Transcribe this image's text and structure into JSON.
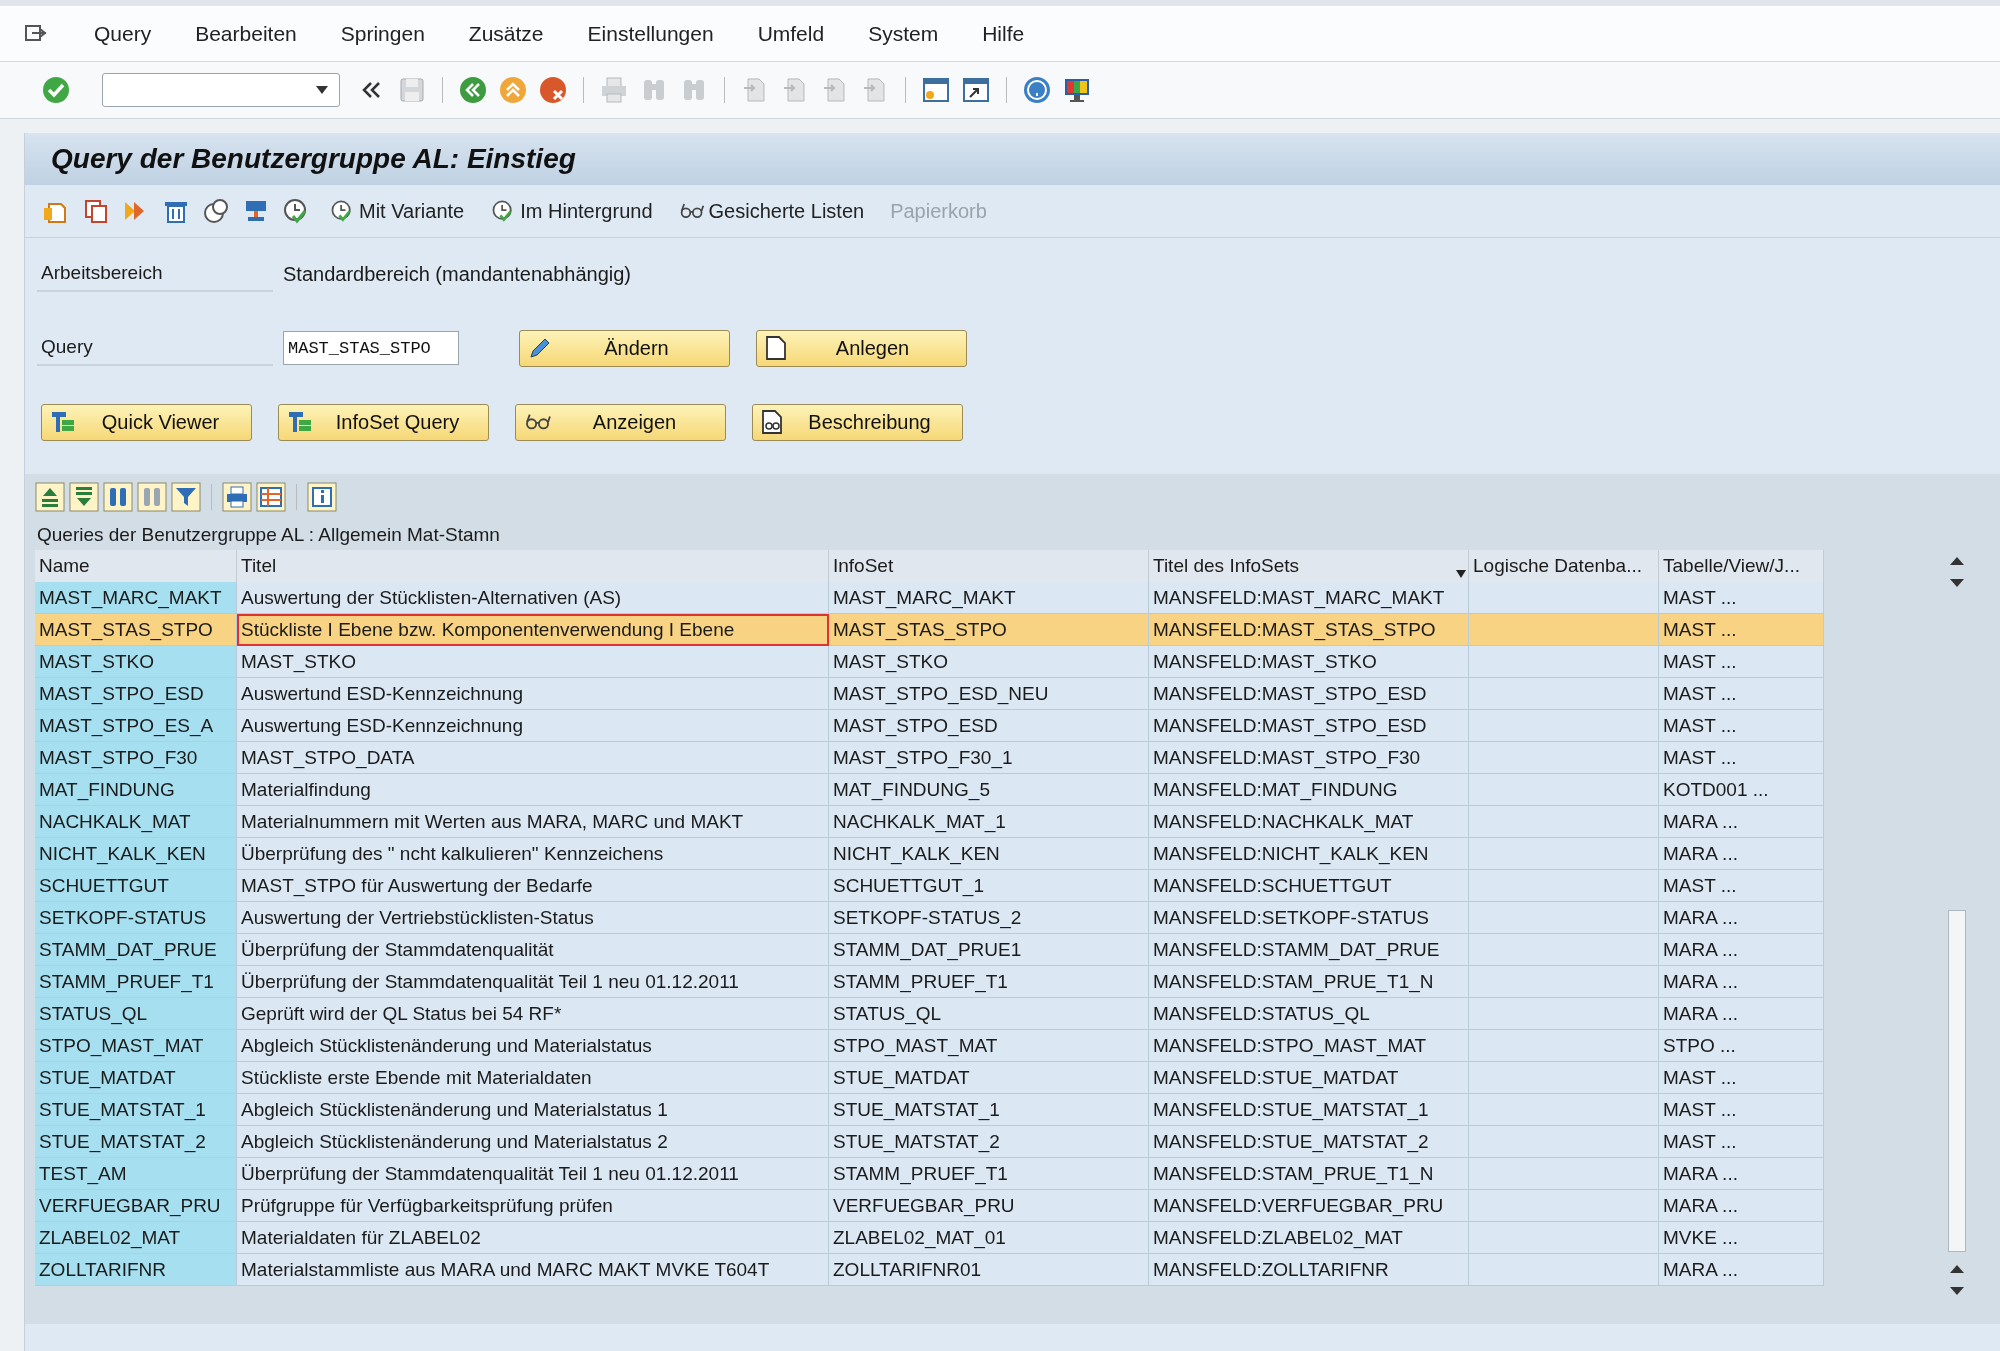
{
  "menu": [
    "Query",
    "Bearbeiten",
    "Springen",
    "Zusätze",
    "Einstellungen",
    "Umfeld",
    "System",
    "Hilfe"
  ],
  "screen_title": "Query der Benutzergruppe AL: Einstieg",
  "app_toolbar": [
    {
      "label": "Mit Variante",
      "kind": "clock",
      "disabled": false
    },
    {
      "label": "Im Hintergrund",
      "kind": "clock",
      "disabled": false
    },
    {
      "label": "Gesicherte Listen",
      "kind": "glasses",
      "disabled": false
    },
    {
      "label": "Papierkorb",
      "kind": "none",
      "disabled": true
    }
  ],
  "workspace": {
    "label": "Arbeitsbereich",
    "value": "Standardbereich (mandantenabhängig)"
  },
  "query": {
    "label": "Query",
    "value": "MAST_STAS_STPO"
  },
  "buttons": [
    {
      "label": "Ändern",
      "kind": "pencil"
    },
    {
      "label": "Anlegen",
      "kind": "document"
    },
    {
      "label": "Quick Viewer",
      "kind": "blocks"
    },
    {
      "label": "InfoSet Query",
      "kind": "blocks"
    },
    {
      "label": "Anzeigen",
      "kind": "glasses"
    },
    {
      "label": "Beschreibung",
      "kind": "docglasses"
    }
  ],
  "list_title": "Queries der Benutzergruppe AL : Allgemein Mat-Stamn",
  "table": {
    "columns": [
      "Name",
      "Titel",
      "InfoSet",
      "Titel des InfoSets",
      "Logische Datenba...",
      "Tabelle/View/J..."
    ],
    "rows": [
      {
        "name": "MAST_MARC_MAKT",
        "title": "Auswertung der Stücklisten-Alternativen (AS)",
        "infoset": "MAST_MARC_MAKT",
        "infoset_title": "MANSFELD:MAST_MARC_MAKT",
        "table": "MAST ...",
        "selected": false
      },
      {
        "name": "MAST_STAS_STPO",
        "title": "Stückliste I Ebene bzw. Komponentenverwendung I Ebene",
        "infoset": "MAST_STAS_STPO",
        "infoset_title": "MANSFELD:MAST_STAS_STPO",
        "table": "MAST ...",
        "selected": true
      },
      {
        "name": "MAST_STKO",
        "title": "MAST_STKO",
        "infoset": "MAST_STKO",
        "infoset_title": "MANSFELD:MAST_STKO",
        "table": "MAST ...",
        "selected": false
      },
      {
        "name": "MAST_STPO_ESD",
        "title": "Auswertund ESD-Kennzeichnung",
        "infoset": "MAST_STPO_ESD_NEU",
        "infoset_title": "MANSFELD:MAST_STPO_ESD",
        "table": "MAST ...",
        "selected": false
      },
      {
        "name": "MAST_STPO_ES_A",
        "title": "Auswertung ESD-Kennzeichnung",
        "infoset": "MAST_STPO_ESD",
        "infoset_title": "MANSFELD:MAST_STPO_ESD",
        "table": "MAST ...",
        "selected": false
      },
      {
        "name": "MAST_STPO_F30",
        "title": "MAST_STPO_DATA",
        "infoset": "MAST_STPO_F30_1",
        "infoset_title": "MANSFELD:MAST_STPO_F30",
        "table": "MAST ...",
        "selected": false
      },
      {
        "name": "MAT_FINDUNG",
        "title": "Materialfindung",
        "infoset": "MAT_FINDUNG_5",
        "infoset_title": "MANSFELD:MAT_FINDUNG",
        "table": "KOTD001 ...",
        "selected": false
      },
      {
        "name": "NACHKALK_MAT",
        "title": "Materialnummern mit Werten aus MARA, MARC und MAKT",
        "infoset": "NACHKALK_MAT_1",
        "infoset_title": "MANSFELD:NACHKALK_MAT",
        "table": "MARA ...",
        "selected": false
      },
      {
        "name": "NICHT_KALK_KEN",
        "title": "Überprüfung des \" ncht kalkulieren\" Kennzeichens",
        "infoset": "NICHT_KALK_KEN",
        "infoset_title": "MANSFELD:NICHT_KALK_KEN",
        "table": "MARA ...",
        "selected": false
      },
      {
        "name": "SCHUETTGUT",
        "title": "MAST_STPO für Auswertung der Bedarfe",
        "infoset": "SCHUETTGUT_1",
        "infoset_title": "MANSFELD:SCHUETTGUT",
        "table": "MAST ...",
        "selected": false
      },
      {
        "name": "SETKOPF-STATUS",
        "title": "Auswertung der Vertriebstücklisten-Status",
        "infoset": "SETKOPF-STATUS_2",
        "infoset_title": "MANSFELD:SETKOPF-STATUS",
        "table": "MARA ...",
        "selected": false
      },
      {
        "name": "STAMM_DAT_PRUE",
        "title": "Überprüfung der Stammdatenqualität",
        "infoset": "STAMM_DAT_PRUE1",
        "infoset_title": "MANSFELD:STAMM_DAT_PRUE",
        "table": "MARA ...",
        "selected": false
      },
      {
        "name": "STAMM_PRUEF_T1",
        "title": "Überprüfung der Stammdatenqualität Teil 1 neu 01.12.2011",
        "infoset": "STAMM_PRUEF_T1",
        "infoset_title": "MANSFELD:STAM_PRUE_T1_N",
        "table": "MARA ...",
        "selected": false
      },
      {
        "name": "STATUS_QL",
        "title": "Geprüft wird der QL Status bei 54 RF*",
        "infoset": "STATUS_QL",
        "infoset_title": "MANSFELD:STATUS_QL",
        "table": "MARA ...",
        "selected": false
      },
      {
        "name": "STPO_MAST_MAT",
        "title": "Abgleich Stücklistenänderung und Materialstatus",
        "infoset": "STPO_MAST_MAT",
        "infoset_title": "MANSFELD:STPO_MAST_MAT",
        "table": "STPO ...",
        "selected": false
      },
      {
        "name": "STUE_MATDAT",
        "title": "Stückliste erste Ebende mit Materialdaten",
        "infoset": "STUE_MATDAT",
        "infoset_title": "MANSFELD:STUE_MATDAT",
        "table": "MAST ...",
        "selected": false
      },
      {
        "name": "STUE_MATSTAT_1",
        "title": "Abgleich Stücklistenänderung und Materialstatus 1",
        "infoset": "STUE_MATSTAT_1",
        "infoset_title": "MANSFELD:STUE_MATSTAT_1",
        "table": "MAST ...",
        "selected": false
      },
      {
        "name": "STUE_MATSTAT_2",
        "title": "Abgleich Stücklistenänderung und Materialstatus 2",
        "infoset": "STUE_MATSTAT_2",
        "infoset_title": "MANSFELD:STUE_MATSTAT_2",
        "table": "MAST ...",
        "selected": false
      },
      {
        "name": "TEST_AM",
        "title": "Überprüfung der Stammdatenqualität Teil 1 neu 01.12.2011",
        "infoset": "STAMM_PRUEF_T1",
        "infoset_title": "MANSFELD:STAM_PRUE_T1_N",
        "table": "MARA ...",
        "selected": false
      },
      {
        "name": "VERFUEGBAR_PRU",
        "title": "Prüfgruppe für Verfügbarkeitsprüfung prüfen",
        "infoset": "VERFUEGBAR_PRU",
        "infoset_title": "MANSFELD:VERFUEGBAR_PRU",
        "table": "MARA ...",
        "selected": false
      },
      {
        "name": "ZLABEL02_MAT",
        "title": "Materialdaten für ZLABEL02",
        "infoset": "ZLABEL02_MAT_01",
        "infoset_title": "MANSFELD:ZLABEL02_MAT",
        "table": "MVKE ...",
        "selected": false
      },
      {
        "name": "ZOLLTARIFNR",
        "title": "Materialstammliste aus MARA und MARC MAKT MVKE T604T",
        "infoset": "ZOLLTARIFNR01",
        "infoset_title": "MANSFELD:ZOLLTARIFNR",
        "table": "MARA ...",
        "selected": false
      }
    ]
  }
}
